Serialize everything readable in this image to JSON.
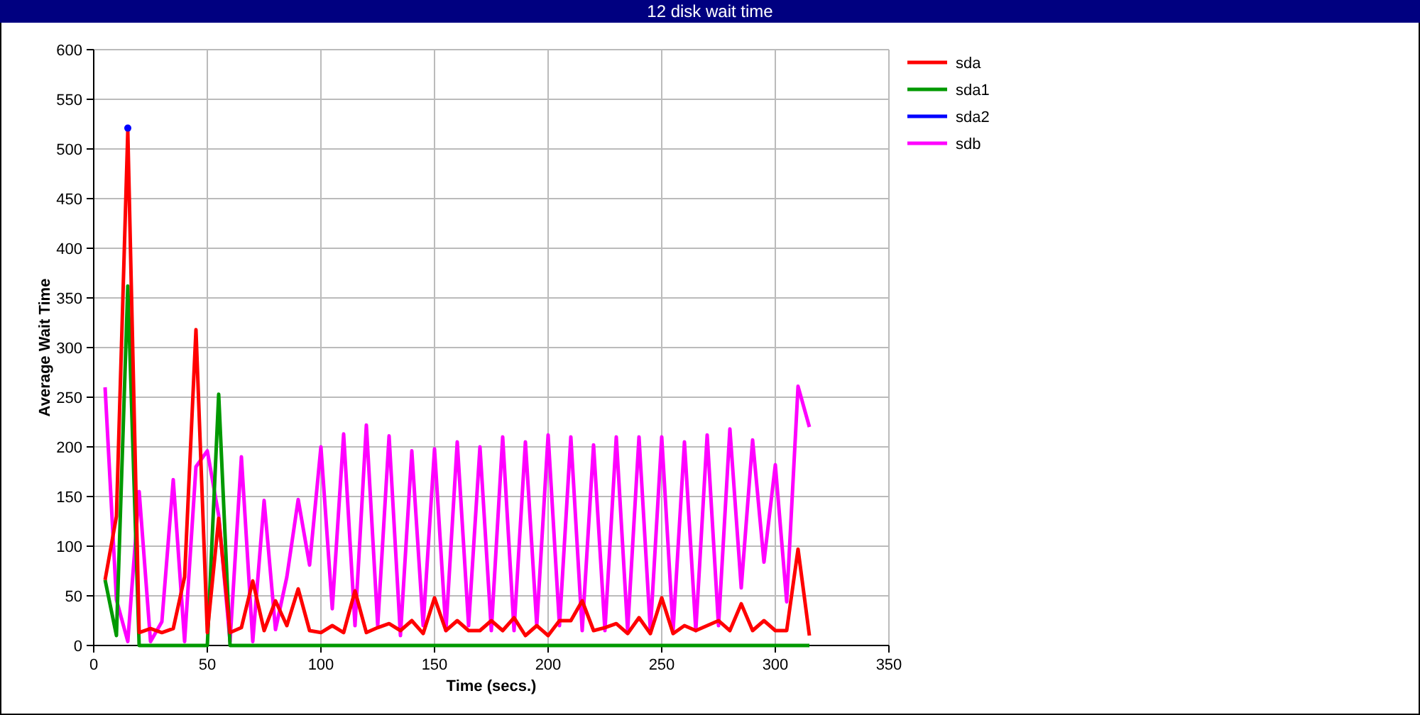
{
  "window": {
    "title": "12 disk wait time"
  },
  "chart": {
    "chart_data": {
      "type": "line",
      "xlabel": "Time (secs.)",
      "ylabel": "Average Wait Time",
      "x": [
        5,
        10,
        15,
        20,
        25,
        30,
        35,
        40,
        45,
        50,
        55,
        60,
        65,
        70,
        75,
        80,
        85,
        90,
        95,
        100,
        105,
        110,
        115,
        120,
        125,
        130,
        135,
        140,
        145,
        150,
        155,
        160,
        165,
        170,
        175,
        180,
        185,
        190,
        195,
        200,
        205,
        210,
        215,
        220,
        225,
        230,
        235,
        240,
        245,
        250,
        255,
        260,
        265,
        270,
        275,
        280,
        285,
        290,
        295,
        300,
        305,
        310,
        315
      ],
      "series": [
        {
          "name": "sda",
          "color": "#ff0000",
          "values": [
            66,
            130,
            518,
            13,
            17,
            13,
            17,
            69,
            318,
            13,
            128,
            13,
            18,
            65,
            15,
            45,
            20,
            57,
            15,
            13,
            20,
            13,
            55,
            13,
            18,
            22,
            15,
            25,
            12,
            48,
            15,
            25,
            15,
            15,
            25,
            15,
            28,
            10,
            20,
            10,
            25,
            25,
            45,
            15,
            18,
            22,
            12,
            28,
            12,
            48,
            12,
            20,
            15,
            20,
            25,
            15,
            42,
            15,
            25,
            15,
            15,
            97,
            10
          ]
        },
        {
          "name": "sda1",
          "color": "#009900",
          "values": [
            66,
            10,
            362,
            0,
            0,
            0,
            0,
            0,
            0,
            0,
            253,
            0,
            0,
            0,
            0,
            0,
            0,
            0,
            0,
            0,
            0,
            0,
            0,
            0,
            0,
            0,
            0,
            0,
            0,
            0,
            0,
            0,
            0,
            0,
            0,
            0,
            0,
            0,
            0,
            0,
            0,
            0,
            0,
            0,
            0,
            0,
            0,
            0,
            0,
            0,
            0,
            0,
            0,
            0,
            0,
            0,
            0,
            0,
            0,
            0,
            0,
            0,
            0
          ]
        },
        {
          "name": "sda2",
          "color": "#0000ff",
          "marker": true,
          "values": [
            null,
            null,
            521,
            null,
            null,
            null,
            null,
            null,
            null,
            null,
            null,
            null,
            null,
            null,
            null,
            null,
            null,
            null,
            null,
            null,
            null,
            null,
            null,
            null,
            null,
            null,
            null,
            null,
            null,
            null,
            null,
            null,
            null,
            null,
            null,
            null,
            null,
            null,
            null,
            null,
            null,
            null,
            null,
            null,
            null,
            null,
            null,
            null,
            null,
            null,
            null,
            null,
            null,
            null,
            null,
            null,
            null,
            null,
            null,
            null,
            null,
            null,
            null
          ]
        },
        {
          "name": "sdb",
          "color": "#ff00ff",
          "values": [
            260,
            46,
            4,
            155,
            4,
            24,
            167,
            4,
            180,
            196,
            131,
            4,
            190,
            4,
            146,
            16,
            69,
            147,
            81,
            200,
            37,
            213,
            20,
            222,
            20,
            211,
            10,
            196,
            20,
            198,
            15,
            205,
            20,
            200,
            15,
            210,
            15,
            205,
            20,
            212,
            20,
            210,
            15,
            202,
            15,
            210,
            15,
            210,
            15,
            210,
            15,
            205,
            15,
            212,
            20,
            218,
            58,
            207,
            84,
            182,
            44,
            261,
            220
          ]
        }
      ],
      "grid": true,
      "legend": true,
      "xlim": [
        0,
        350
      ],
      "ylim": [
        0,
        600
      ],
      "xticks": [
        0,
        50,
        100,
        150,
        200,
        250,
        300,
        350
      ],
      "yticks": [
        0,
        50,
        100,
        150,
        200,
        250,
        300,
        350,
        400,
        450,
        500,
        550,
        600
      ]
    }
  }
}
